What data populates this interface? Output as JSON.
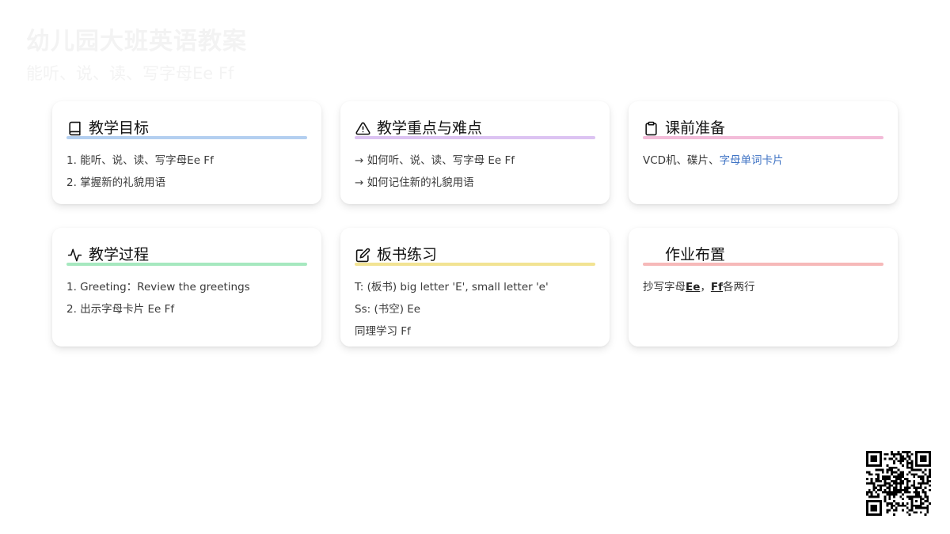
{
  "header": {
    "title": "幼儿园大班英语教案",
    "subtitle": "能听、说、读、写字母Ee Ff"
  },
  "cards": [
    {
      "title": "教学目标",
      "icon": "book-icon",
      "accent": "#b3cff0",
      "lines": [
        "1. 能听、说、读、写字母Ee Ff",
        "2. 掌握新的礼貌用语"
      ]
    },
    {
      "title": "教学重点与难点",
      "icon": "warning-triangle-icon",
      "accent": "#dcc3f2",
      "lines": [
        "→ 如何听、说、读、写字母 Ee Ff",
        "→ 如何记住新的礼貌用语"
      ]
    },
    {
      "title": "课前准备",
      "icon": "clipboard-icon",
      "accent": "#f3bcd9",
      "line_prefix": "VCD机、碟片、",
      "line_link": "字母单词卡片"
    },
    {
      "title": "教学过程",
      "icon": "activity-icon",
      "accent": "#a6e8bf",
      "lines": [
        "1. Greeting：Review the greetings",
        "2. 出示字母卡片 Ee Ff"
      ]
    },
    {
      "title": "板书练习",
      "icon": "edit-icon",
      "accent": "#f2e393",
      "lines": [
        "T: (板书) big letter 'E', small letter 'e'",
        "Ss: (书空) Ee",
        "同理学习 Ff"
      ]
    },
    {
      "title": "作业布置",
      "accent": "#f6b9b9",
      "hw_pre": "抄写字母",
      "hw_e": "Ee",
      "hw_sep": "，",
      "hw_f": "Ff",
      "hw_post": "各两行"
    }
  ]
}
